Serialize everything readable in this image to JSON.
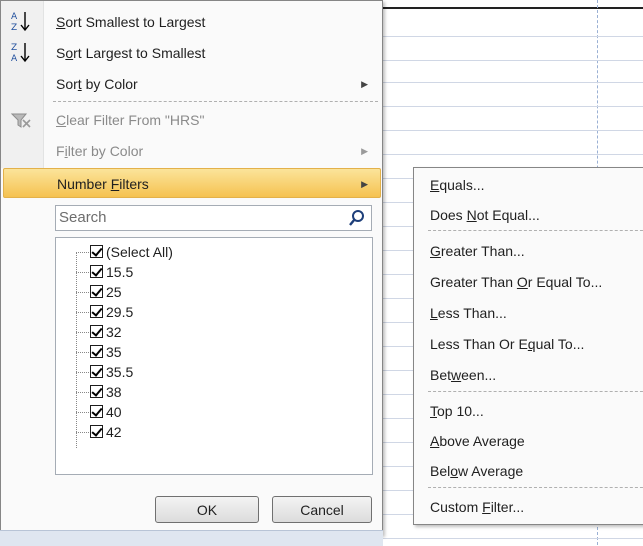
{
  "sort_menu": {
    "sort_asc": {
      "pre": "",
      "ul": "S",
      "post": "ort Smallest to Largest"
    },
    "sort_desc": {
      "pre": "S",
      "ul": "o",
      "post": "rt Largest to Smallest"
    },
    "sort_color": {
      "pre": "Sor",
      "ul": "t",
      "post": " by Color"
    },
    "clear_filter": {
      "pre": "",
      "ul": "C",
      "post": "lear Filter From \"HRS\""
    },
    "filter_color": {
      "pre": "F",
      "ul": "i",
      "post": "lter by Color"
    },
    "number_filters": {
      "pre": "Number ",
      "ul": "F",
      "post": "ilters"
    }
  },
  "search": {
    "placeholder": "Search"
  },
  "values": [
    "(Select All)",
    "15.5",
    "25",
    "29.5",
    "32",
    "35",
    "35.5",
    "38",
    "40",
    "42"
  ],
  "buttons": {
    "ok": "OK",
    "cancel": "Cancel"
  },
  "submenu": {
    "equals": {
      "pre": "",
      "ul": "E",
      "post": "quals..."
    },
    "not_equal": {
      "pre": "Does ",
      "ul": "N",
      "post": "ot Equal..."
    },
    "greater": {
      "pre": "",
      "ul": "G",
      "post": "reater Than..."
    },
    "greater_eq": {
      "pre": "Greater Than ",
      "ul": "O",
      "post": "r Equal To..."
    },
    "less": {
      "pre": "",
      "ul": "L",
      "post": "ess Than..."
    },
    "less_eq": {
      "pre": "Less Than Or E",
      "ul": "q",
      "post": "ual To..."
    },
    "between": {
      "pre": "Bet",
      "ul": "w",
      "post": "een..."
    },
    "top10": {
      "pre": "",
      "ul": "T",
      "post": "op 10..."
    },
    "above_avg": {
      "pre": "",
      "ul": "A",
      "post": "bove Average"
    },
    "below_avg": {
      "pre": "Bel",
      "ul": "o",
      "post": "w Average"
    },
    "custom": {
      "pre": "Custom ",
      "ul": "F",
      "post": "ilter..."
    }
  },
  "colors": {
    "highlight": "#f5c251",
    "menu_bg": "#fafafa",
    "border": "#868686"
  }
}
